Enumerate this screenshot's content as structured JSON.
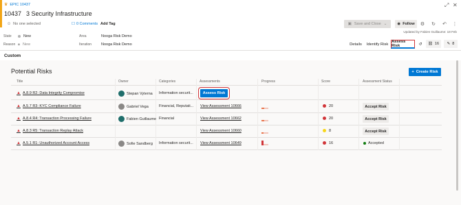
{
  "header": {
    "epic_label": "EPIC 10437",
    "id": "10437",
    "title": "3 Security Infrastructure",
    "assignee": "No one selected",
    "comments": "0 Comments",
    "add_tag": "Add Tag",
    "save_label": "Save and Close",
    "follow_label": "Follow",
    "updated_by": "Updated by Fabien Guillaume: 18 Feb"
  },
  "fields": {
    "state_label": "State",
    "state_value": "New",
    "reason_label": "Reason",
    "reason_value": "New",
    "area_label": "Area",
    "area_value": "Nooga Risk Demo",
    "iteration_label": "Iteration",
    "iteration_value": "Nooga Risk Demo"
  },
  "tabs": {
    "details": "Details",
    "identify": "Identify Risk",
    "assess": "Assess Risk",
    "links_count": "16",
    "attach_count": "8"
  },
  "section": {
    "custom_label": "Custom",
    "title": "Potential Risks",
    "create_label": "Create Risk"
  },
  "table": {
    "columns": [
      "Title",
      "Owner",
      "Categories",
      "Assessments",
      "Progress",
      "Score",
      "Assessment Status"
    ],
    "rows": [
      {
        "title": "A.8.9 R2: Data Integrity Compromise",
        "owner": "Stepan Vyterna",
        "categories": "Information securit...",
        "assessment": "Assess Risk",
        "score": "",
        "status": ""
      },
      {
        "title": "A.5.7 R3: KYC Compliance Failure",
        "owner": "Gabriel Vega",
        "categories": "Financial, Reputati...",
        "assessment": "View Assessment 10666",
        "score": "20",
        "status": "Accept Risk"
      },
      {
        "title": "A.8.4 R4: Transaction Processing Failure",
        "owner": "Fabien Guillaume",
        "categories": "Financial",
        "assessment": "View Assessment 10662",
        "score": "20",
        "status": "Accept Risk"
      },
      {
        "title": "A.8.3 R5: Transaction Replay Attack",
        "owner": "",
        "categories": "",
        "assessment": "View Assessment 10660",
        "score": "8",
        "status": "Accept Risk"
      },
      {
        "title": "A.5.1 R1: Unauthorized Account Access",
        "owner": "Sofie Sandberg",
        "categories": "Information securit...",
        "assessment": "View Assessment 10649",
        "score": "16",
        "status": "Accepted"
      }
    ]
  },
  "colors": {
    "accent": "#0078d4",
    "epic": "#f2a516",
    "highlight": "#d13438",
    "score_red": "#d13438",
    "score_yellow": "#f7d61b",
    "accepted_green": "#107c10"
  }
}
